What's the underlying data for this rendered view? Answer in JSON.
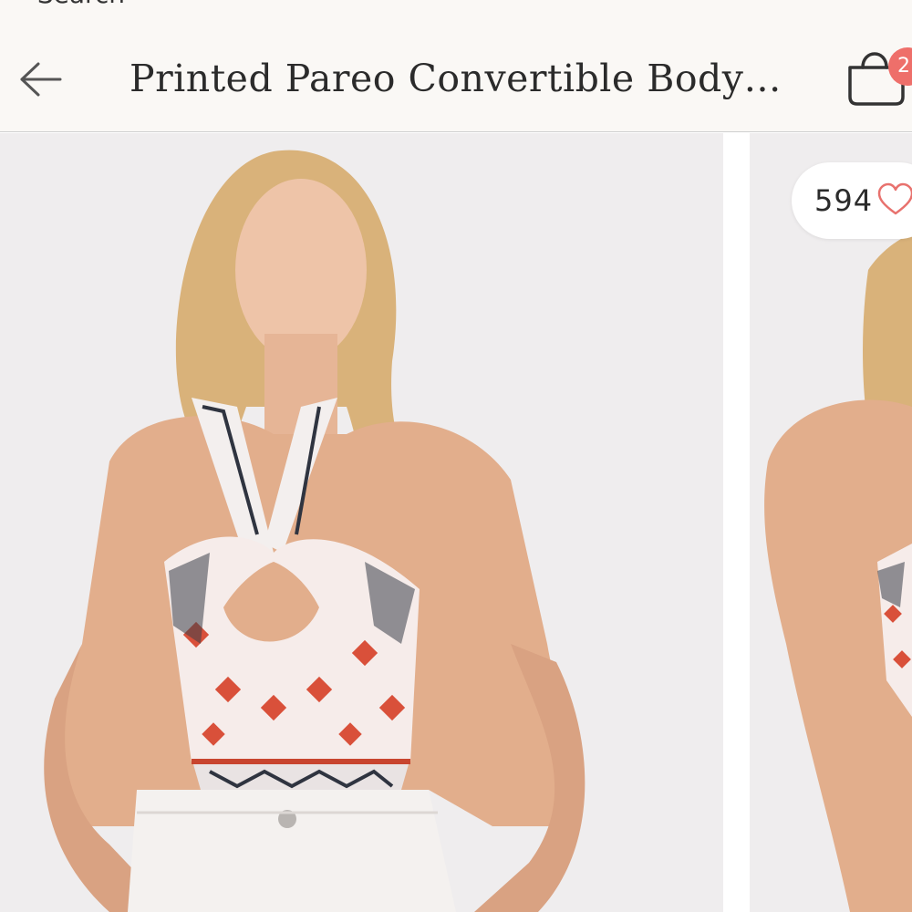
{
  "nav": {
    "back_to": "Search"
  },
  "header": {
    "title": "Printed Pareo Convertible Body…",
    "bag_count": "2"
  },
  "product": {
    "likes": "594"
  },
  "icons": {
    "back": "arrow-left-icon",
    "bag": "shopping-bag-icon",
    "like": "heart-outline-icon"
  },
  "colors": {
    "header_bg": "#faf8f5",
    "badge": "#ee6f6a",
    "text": "#2b2b2b",
    "heart": "#e8726e"
  }
}
